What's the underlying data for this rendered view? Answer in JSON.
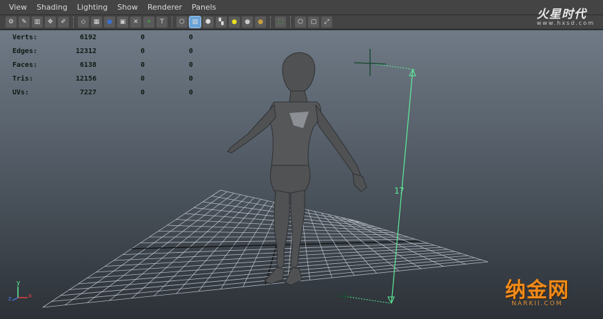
{
  "menu": [
    "View",
    "Shading",
    "Lighting",
    "Show",
    "Renderer",
    "Panels"
  ],
  "toolbar": {
    "icons": [
      "camera-attributes-icon",
      "bookmarks-icon",
      "image-plane-icon",
      "two-d-pan-icon",
      "grease-pencil-icon",
      "sep",
      "wireframe-icon",
      "smooth-shade-icon",
      "default-material-icon",
      "textured-icon",
      "xray-icon",
      "use-all-lights-icon",
      "text-icon",
      "sep",
      "isolate-select-icon",
      "cube-shaded-icon",
      "cube-textured-icon",
      "checker-icon",
      "light-bulb-icon",
      "sphere-grey-icon",
      "sphere-gold-icon",
      "sep",
      "select-camera-icon",
      "sep",
      "box-icon",
      "frame-icon",
      "share-icon"
    ],
    "active_icon": "cube-shaded-icon"
  },
  "hud": {
    "rows": [
      {
        "label": "Verts:",
        "value": "6192",
        "sel1": "0",
        "sel2": "0"
      },
      {
        "label": "Edges:",
        "value": "12312",
        "sel1": "0",
        "sel2": "0"
      },
      {
        "label": "Faces:",
        "value": "6138",
        "sel1": "0",
        "sel2": "0"
      },
      {
        "label": "Tris:",
        "value": "12156",
        "sel1": "0",
        "sel2": "0"
      },
      {
        "label": "UVs:",
        "value": "7227",
        "sel1": "0",
        "sel2": "0"
      }
    ]
  },
  "scene": {
    "measure_value": "17",
    "grid_color": "#c9ced6",
    "measure_color": "#5df09a",
    "model_color": "#555555"
  },
  "axis": {
    "x": "x",
    "y": "y",
    "z": "z"
  },
  "brand": {
    "logo": "火星时代",
    "url": "www.hxsd.com"
  },
  "watermark": {
    "logo": "纳金网",
    "url": "NARKII.COM"
  }
}
